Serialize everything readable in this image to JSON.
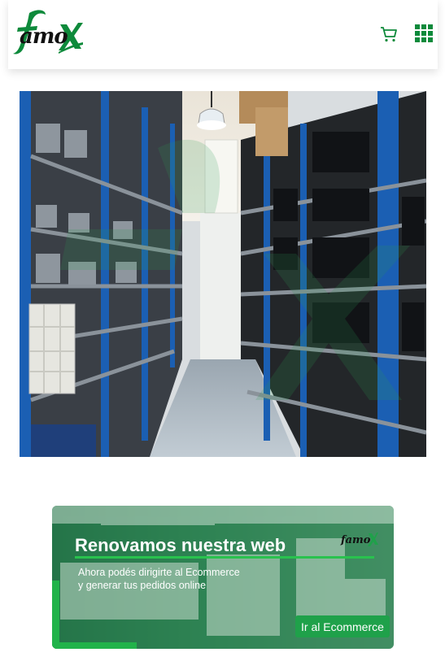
{
  "header": {
    "logo_text": "amo",
    "logo_letter_f": "f",
    "logo_letter_x": "X",
    "brand_color": "#0e8a3b",
    "cart_icon": "cart-icon",
    "menu_icon": "grid-menu-icon"
  },
  "hero": {
    "image": "warehouse-shelves-photo"
  },
  "banner": {
    "title": "Renovamos nuestra web",
    "subtitle_line1": "Ahora podés dirigirte al Ecommerce",
    "subtitle_line2": "y generar tus pedidos online",
    "button_label": "Ir al Ecommerce",
    "logo_text": "famoX",
    "accent_color": "#21b34a"
  }
}
